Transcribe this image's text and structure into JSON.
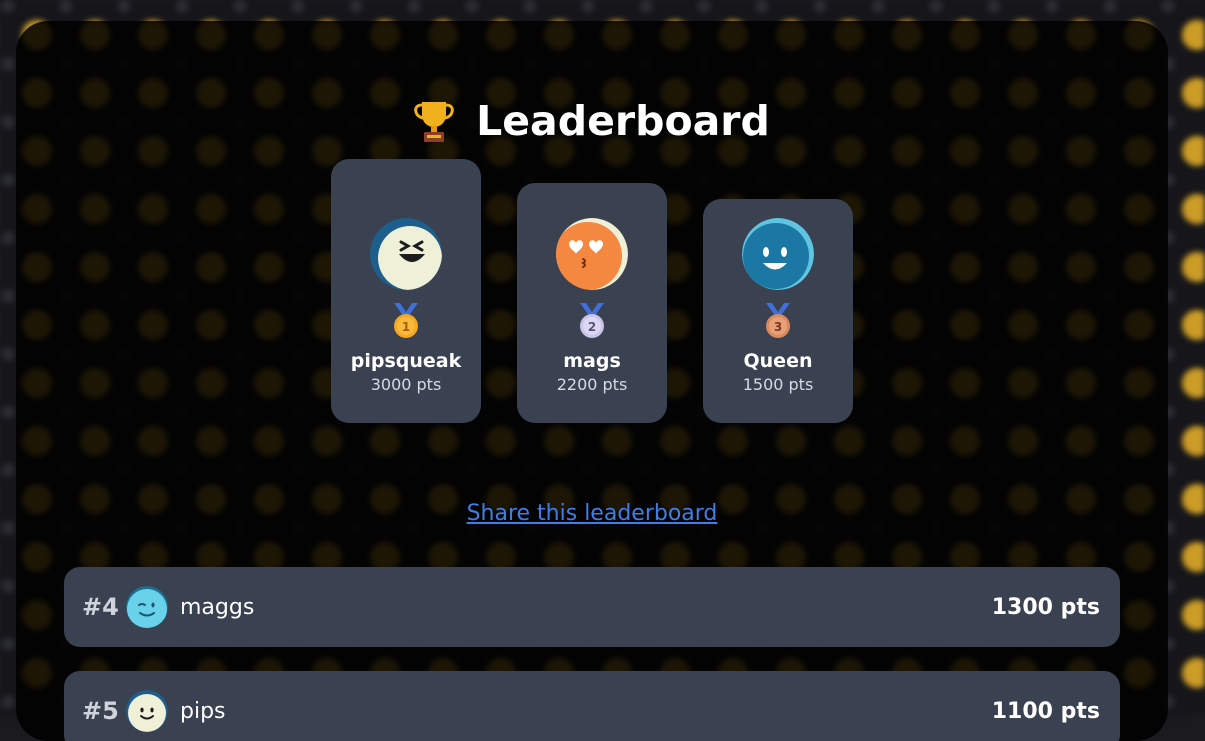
{
  "title": "Leaderboard",
  "podium": [
    {
      "place": "1",
      "name": "pipsqueak",
      "points": "3000 pts",
      "avatar": "grinning-ghost-avatar",
      "medal_color": "#f5a623"
    },
    {
      "place": "2",
      "name": "mags",
      "points": "2200 pts",
      "avatar": "heart-eyes-orange-avatar",
      "medal_color": "#c9c4e8"
    },
    {
      "place": "3",
      "name": "Queen",
      "points": "1500 pts",
      "avatar": "smiling-blue-avatar",
      "medal_color": "#d98b5f"
    }
  ],
  "share_link": "Share this leaderboard",
  "rows": [
    {
      "rank": "#4",
      "name": "maggs",
      "points": "1300 pts",
      "avatar": "winking-cyan-avatar"
    },
    {
      "rank": "#5",
      "name": "pips",
      "points": "1100 pts",
      "avatar": "smiling-cream-avatar"
    }
  ],
  "colors": {
    "card_bg": "#3a4150",
    "link": "#3f7ee8",
    "panel_bg": "#000000"
  }
}
